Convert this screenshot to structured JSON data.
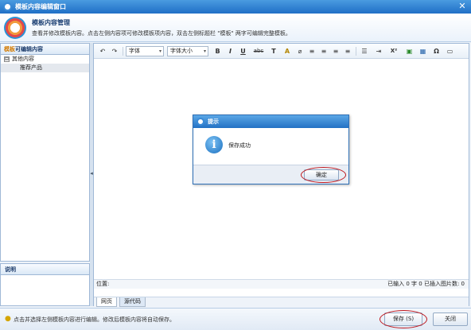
{
  "window": {
    "title": "模板内容编辑窗口",
    "close_glyph": "✕"
  },
  "header": {
    "title": "模板内容管理",
    "description": "查看并修改模板内容。点击左侧内容项可修改模板项内容，双击左侧标题栏 \"模板\" 两字可编辑完整模板。"
  },
  "left_panel": {
    "title_highlight": "模板",
    "title_rest": "可编辑内容",
    "tree": [
      {
        "label": "其他内容",
        "expander": "⊟"
      },
      {
        "label": "推荐产品"
      }
    ]
  },
  "desc_panel": {
    "title": "说明"
  },
  "toolbar": {
    "undo": "↶",
    "redo": "↷",
    "font_family": "字体",
    "font_size": "字体大小",
    "bold": "B",
    "italic": "I",
    "underline": "U",
    "strike": "abc",
    "text_color": "T",
    "bg_color": "A",
    "clear": "⌀",
    "align_left": "≡",
    "align_center": "≡",
    "align_right": "≡",
    "align_justify": "≡",
    "list": "☰",
    "indent": "⇥",
    "superscript": "X²",
    "image": "▣",
    "table": "▦",
    "omega": "Ω",
    "source": "▭"
  },
  "status": {
    "pos_label": "位置:",
    "stats": "已输入 0 字 0 已插入图片数: 0"
  },
  "tabs": [
    {
      "label": "网页"
    },
    {
      "label": "源代码"
    }
  ],
  "bottom": {
    "hint": "点击并选择左侧模板内容进行编辑。修改后模板内容将自动保存。",
    "save_label": "保存 (S)",
    "close_label": "关闭"
  },
  "dialog": {
    "title": "提示",
    "message": "保存成功",
    "ok_label": "确定",
    "info_glyph": "i"
  },
  "colors": {
    "accent": "#1f6fc6",
    "highlight_ring": "#c0191f"
  }
}
